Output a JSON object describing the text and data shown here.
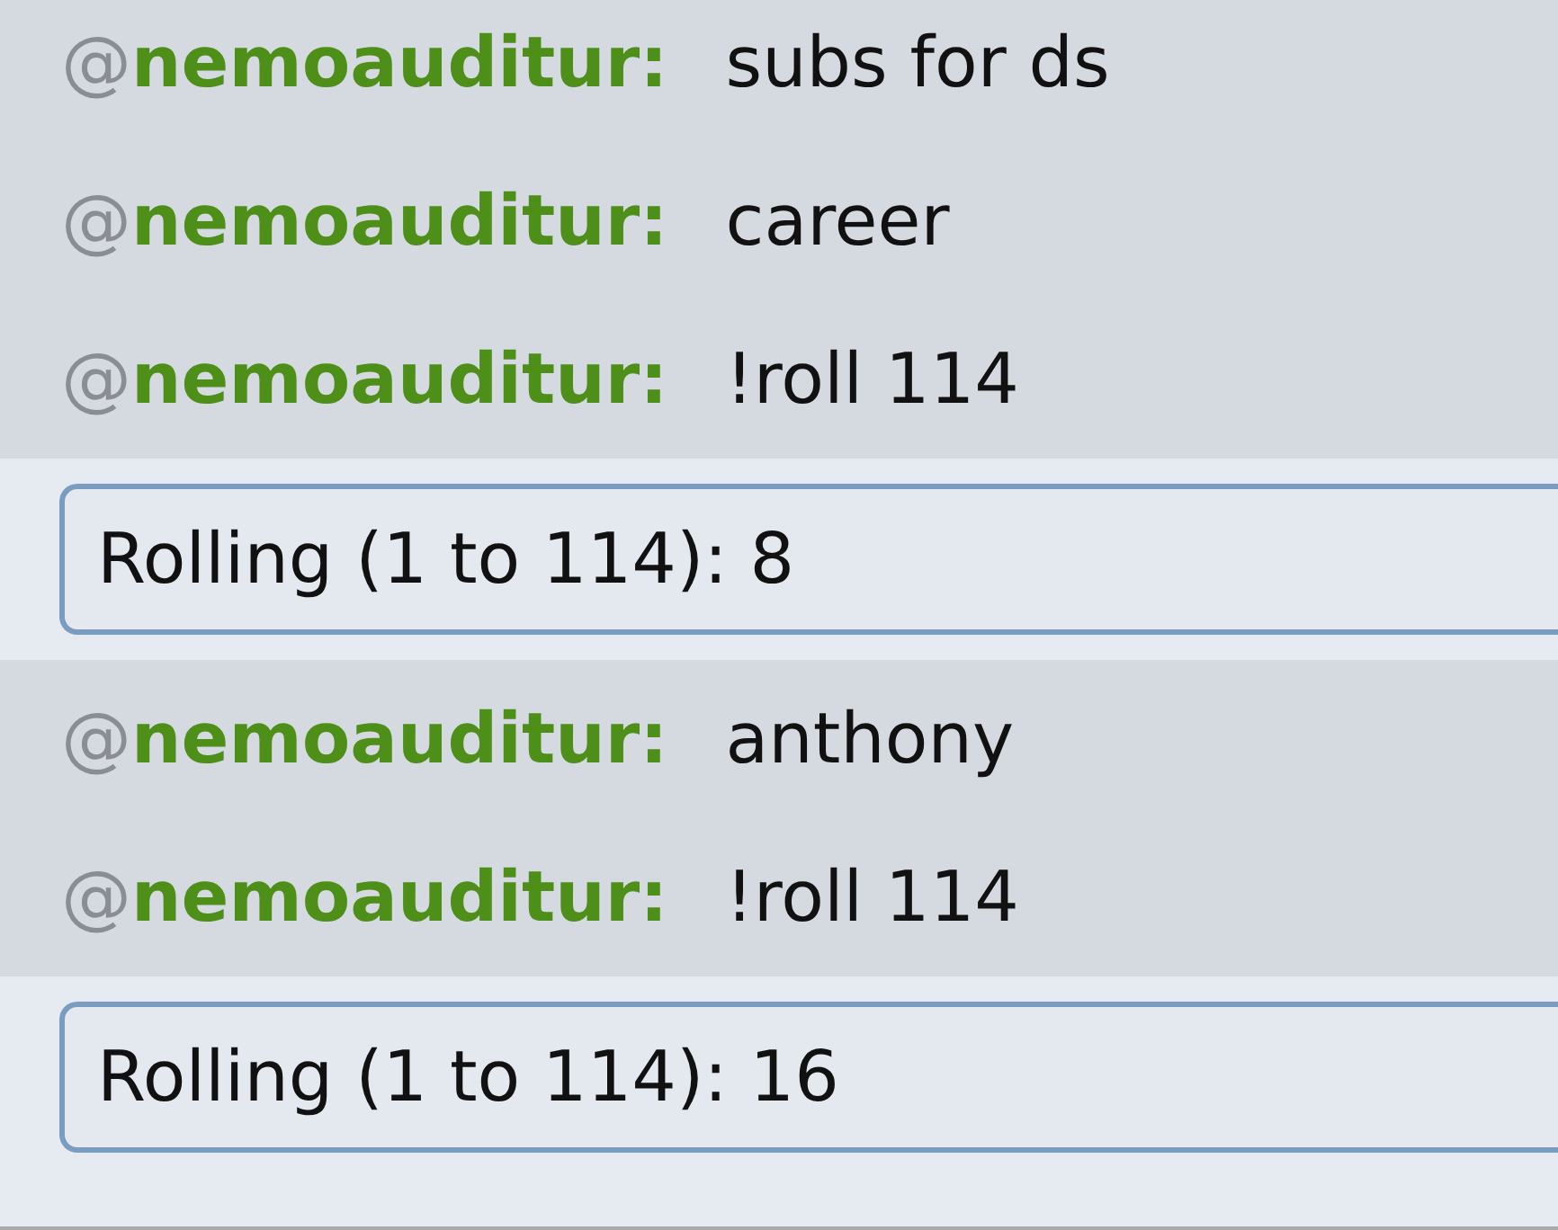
{
  "messages": [
    {
      "kind": "user",
      "at": "@",
      "user": "nemoauditur:",
      "text": "subs for ds"
    },
    {
      "kind": "user",
      "at": "@",
      "user": "nemoauditur:",
      "text": "career"
    },
    {
      "kind": "user",
      "at": "@",
      "user": "nemoauditur:",
      "text": "!roll 114"
    },
    {
      "kind": "bot",
      "text": "Rolling (1 to 114): 8"
    },
    {
      "kind": "user",
      "at": "@",
      "user": "nemoauditur:",
      "text": "anthony"
    },
    {
      "kind": "user",
      "at": "@",
      "user": "nemoauditur:",
      "text": "!roll 114"
    },
    {
      "kind": "bot",
      "text": "Rolling (1 to 114): 16"
    }
  ]
}
